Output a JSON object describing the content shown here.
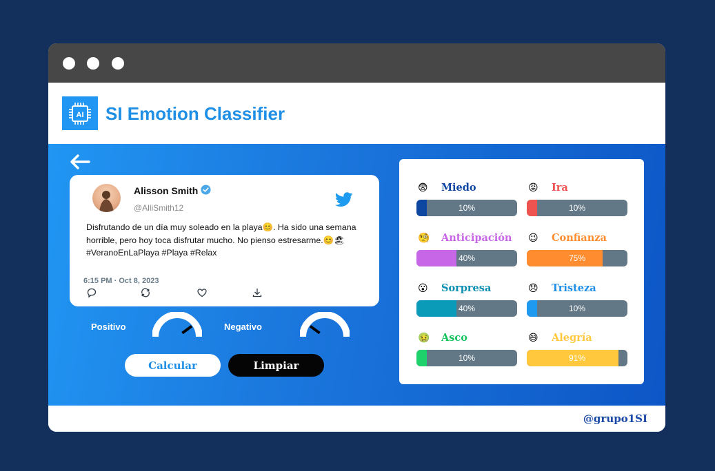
{
  "window": {
    "title": ""
  },
  "header": {
    "app_title": "SI Emotion Classifier",
    "logo_text": "AI"
  },
  "tweet": {
    "name": "Alisson Smith",
    "handle": "@AlliSmith12",
    "text": "Disfrutando de un día muy soleado en la playa😊. Ha sido una semana horrible, pero hoy toca disfrutar mucho. No pienso estresarme.😊🏖 #VeranoEnLaPlaya #Playa #Relax",
    "time": "6:15 PM · Oct 8, 2023"
  },
  "gauges": {
    "positive": {
      "label": "Positivo",
      "value": 0.8
    },
    "negative": {
      "label": "Negativo",
      "value": 0.2
    }
  },
  "buttons": {
    "calc": "Calcular",
    "clear": "Limpiar"
  },
  "emotions": [
    {
      "name": "Miedo",
      "icon": "😨",
      "value": 10,
      "label": "10%",
      "color": "#0d47a1",
      "text_color": "#0d47a1"
    },
    {
      "name": "Ira",
      "icon": "😡",
      "value": 10,
      "label": "10%",
      "color": "#ef5350",
      "text_color": "#ef5350"
    },
    {
      "name": "Anticipación",
      "icon": "🧐",
      "value": 40,
      "label": "40%",
      "color": "#c766e6",
      "text_color": "#c766e6"
    },
    {
      "name": "Confianza",
      "icon": "😉",
      "value": 75,
      "label": "75%",
      "color": "#ff8c2e",
      "text_color": "#ff8c2e"
    },
    {
      "name": "Sorpresa",
      "icon": "😮",
      "value": 40,
      "label": "40%",
      "color": "#0a9bb8",
      "text_color": "#0a8fb0"
    },
    {
      "name": "Tristeza",
      "icon": "😞",
      "value": 10,
      "label": "10%",
      "color": "#1e9af0",
      "text_color": "#1e8ee6"
    },
    {
      "name": "Asco",
      "icon": "🤢",
      "value": 10,
      "label": "10%",
      "color": "#1ed16b",
      "text_color": "#14c25e"
    },
    {
      "name": "Alegría",
      "icon": "😄",
      "value": 91,
      "label": "91%",
      "color": "#ffc83d",
      "text_color": "#ffc83d"
    }
  ],
  "footer": {
    "handle": "@grupo1SI"
  },
  "colors": {
    "background": "#13305d",
    "accent": "#1f8fe6",
    "titlebar": "#474747"
  }
}
